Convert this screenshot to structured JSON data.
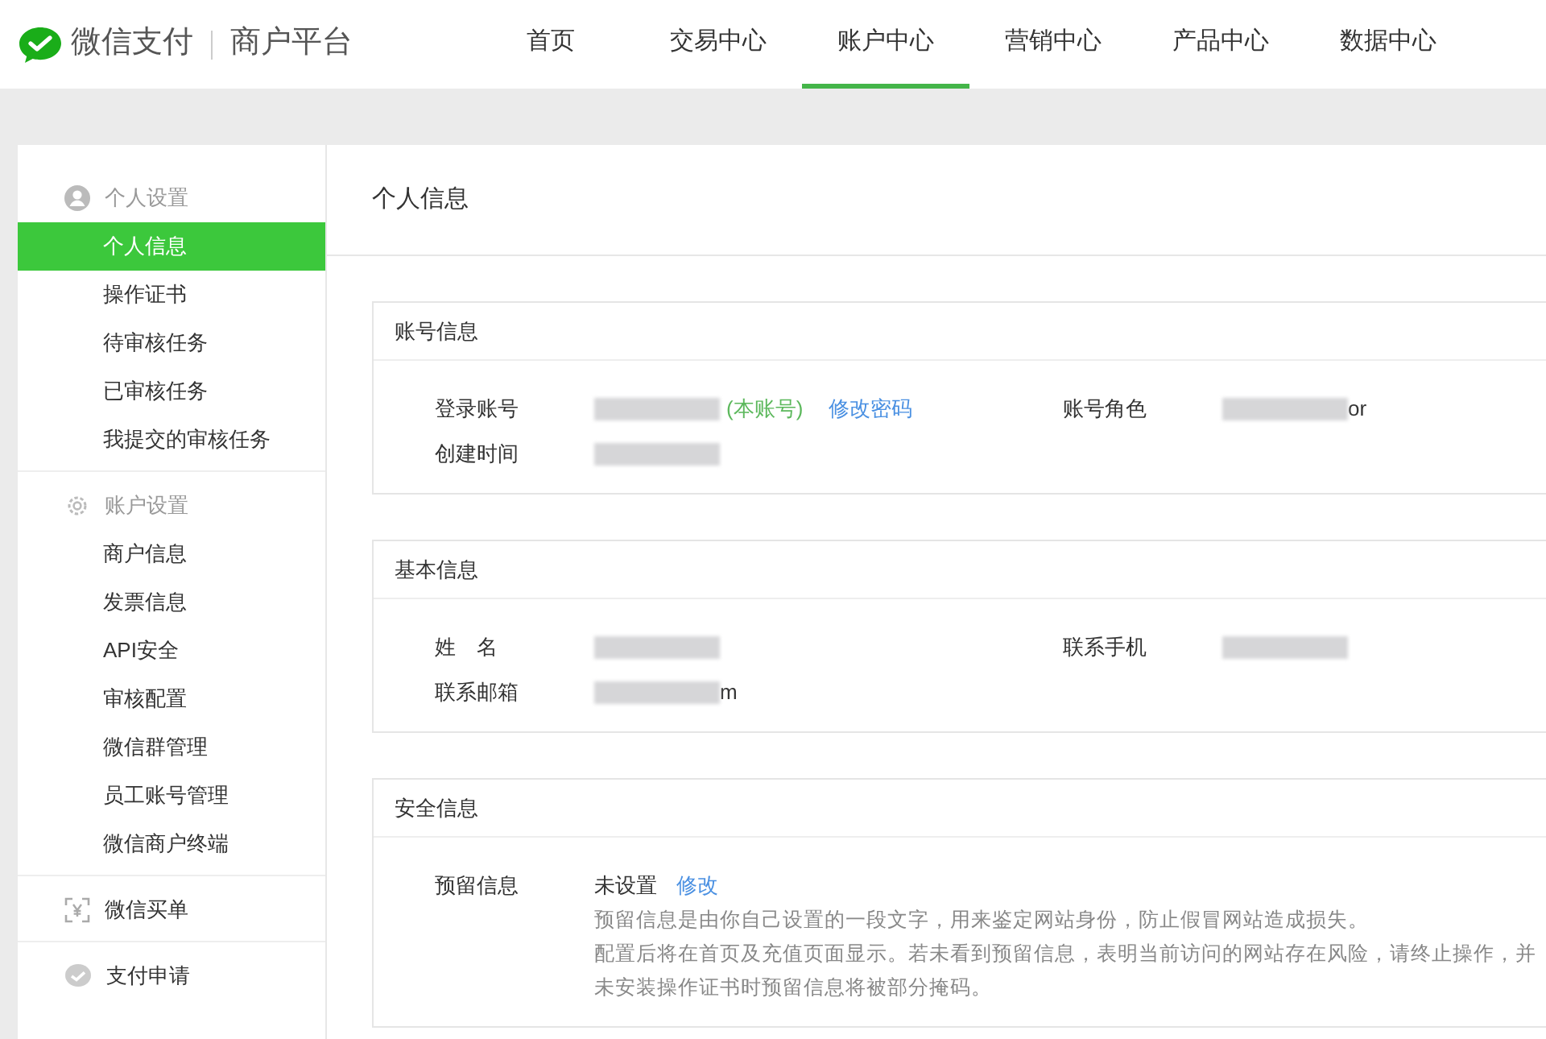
{
  "header": {
    "brand": "微信支付",
    "platform": "商户平台",
    "nav": [
      {
        "label": "首页",
        "selected": false
      },
      {
        "label": "交易中心",
        "selected": false
      },
      {
        "label": "账户中心",
        "selected": true
      },
      {
        "label": "营销中心",
        "selected": false
      },
      {
        "label": "产品中心",
        "selected": false
      },
      {
        "label": "数据中心",
        "selected": false
      }
    ]
  },
  "sidebar": {
    "groups": [
      {
        "title": "个人设置",
        "kind": "person",
        "muted": true,
        "items": [
          {
            "label": "个人信息",
            "selected": true
          },
          {
            "label": "操作证书",
            "selected": false
          },
          {
            "label": "待审核任务",
            "selected": false
          },
          {
            "label": "已审核任务",
            "selected": false
          },
          {
            "label": "我提交的审核任务",
            "selected": false
          }
        ]
      },
      {
        "title": "账户设置",
        "kind": "gear",
        "muted": true,
        "items": [
          {
            "label": "商户信息",
            "selected": false
          },
          {
            "label": "发票信息",
            "selected": false
          },
          {
            "label": "API安全",
            "selected": false
          },
          {
            "label": "审核配置",
            "selected": false
          },
          {
            "label": "微信群管理",
            "selected": false
          },
          {
            "label": "员工账号管理",
            "selected": false
          },
          {
            "label": "微信商户终端",
            "selected": false
          }
        ]
      },
      {
        "title": "微信买单",
        "kind": "yen",
        "muted": false
      },
      {
        "title": "支付申请",
        "kind": "check",
        "muted": false
      }
    ]
  },
  "page_title": "个人信息",
  "cards": [
    {
      "title": "账号信息",
      "rows": [
        [
          {
            "label": "登录账号",
            "value": {
              "redacted": true
            },
            "tag": "(本账号)",
            "link": "修改密码"
          },
          {
            "label": "账号角色",
            "value": {
              "redacted": true,
              "suffix": "or"
            }
          }
        ],
        [
          {
            "label": "创建时间",
            "value": {
              "redacted": true
            }
          }
        ]
      ]
    },
    {
      "title": "基本信息",
      "rows": [
        [
          {
            "label": "姓　名",
            "value": {
              "redacted": true
            }
          },
          {
            "label": "联系手机",
            "value": {
              "redacted": true
            }
          }
        ],
        [
          {
            "label": "联系邮箱",
            "value": {
              "redacted": true,
              "suffix": "m"
            }
          }
        ]
      ]
    },
    {
      "title": "安全信息",
      "rows": [
        [
          {
            "label": "预留信息",
            "value": {
              "text": "未设置"
            },
            "link": "修改",
            "notes": [
              "预留信息是由你自己设置的一段文字，用来鉴定网站身份，防止假冒网站造成损失。",
              "配置后将在首页及充值页面显示。若未看到预留信息，表明当前访问的网站存在风险，请终止操作，并",
              "未安装操作证书时预留信息将被部分掩码。"
            ]
          }
        ]
      ]
    }
  ]
}
